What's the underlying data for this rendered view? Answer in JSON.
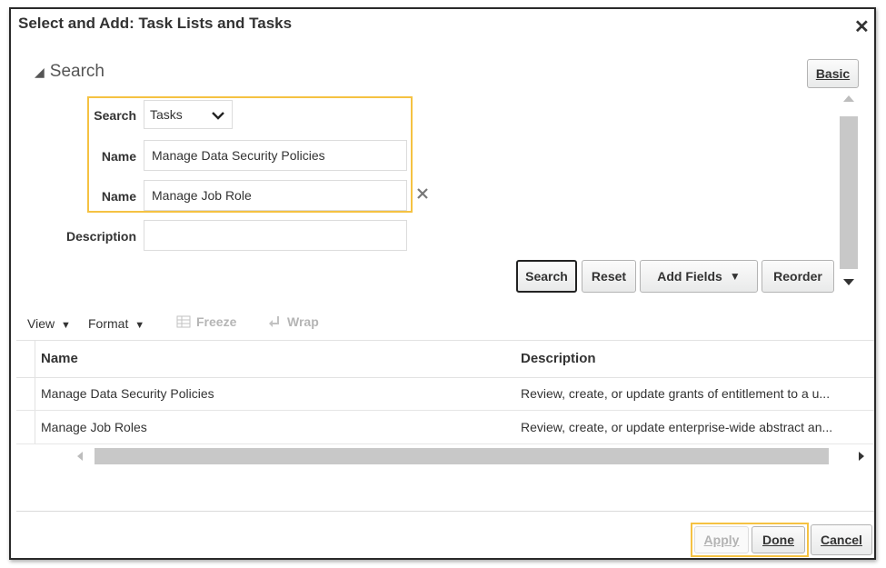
{
  "dialog": {
    "title": "Select and Add: Task Lists and Tasks",
    "close_glyph": "✕"
  },
  "search": {
    "section_label": "Search",
    "basic_button": "Basic",
    "search_by_label": "Search",
    "search_by_value": "Tasks",
    "name1_label": "Name",
    "name1_value": "Manage Data Security Policies",
    "name2_label": "Name",
    "name2_value": "Manage Job Role",
    "description_label": "Description",
    "description_value": "",
    "buttons": {
      "search": "Search",
      "reset": "Reset",
      "add_fields": "Add Fields",
      "reorder": "Reorder"
    }
  },
  "toolbar": {
    "view": "View",
    "format": "Format",
    "freeze": "Freeze",
    "wrap": "Wrap"
  },
  "table": {
    "columns": [
      "Name",
      "Description"
    ],
    "rows": [
      {
        "name": "Manage Data Security Policies",
        "description": "Review, create, or update grants of entitlement to a u..."
      },
      {
        "name": "Manage Job Roles",
        "description": "Review, create, or update enterprise-wide abstract an..."
      }
    ]
  },
  "footer": {
    "apply": "Apply",
    "done": "Done",
    "cancel": "Cancel"
  },
  "colors": {
    "highlight": "#f5c242",
    "border": "#2a2a2a"
  }
}
